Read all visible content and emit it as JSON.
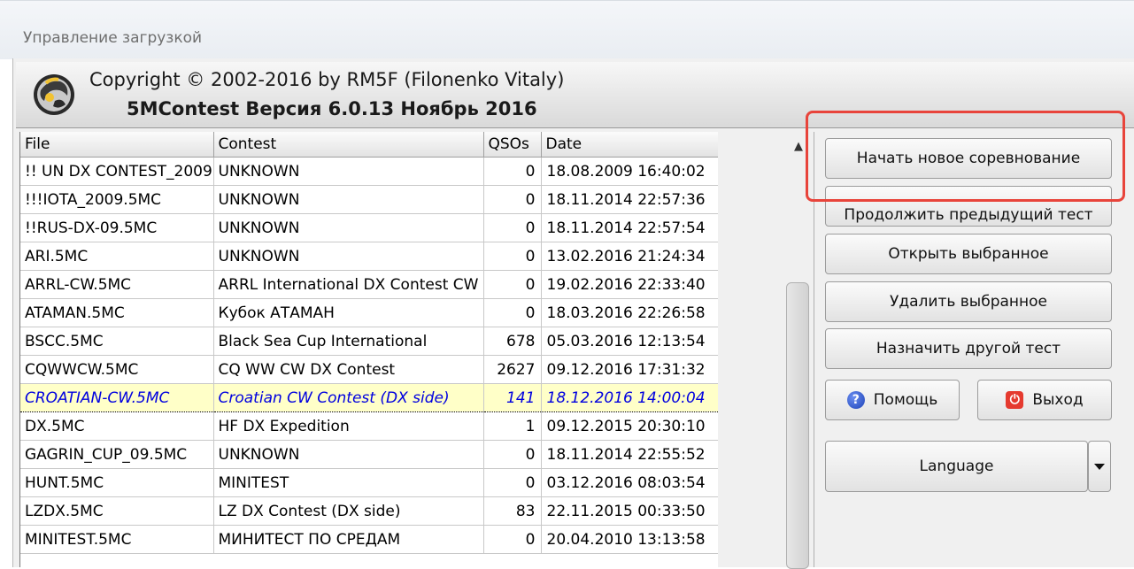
{
  "window": {
    "title": "Управление загрузкой"
  },
  "header": {
    "copyright": "Copyright © 2002-2016 by RM5F (Filonenko Vitaly)",
    "version": "5MContest Версия 6.0.13 Ноябрь 2016"
  },
  "grid": {
    "columns": [
      "File",
      "Contest",
      "QSOs",
      "Date"
    ],
    "rows": [
      {
        "file": "!! UN DX CONTEST_2009",
        "contest": "UNKNOWN",
        "qsos": "0",
        "date": "18.08.2009 16:40:02"
      },
      {
        "file": "!!!IOTA_2009.5MC",
        "contest": "UNKNOWN",
        "qsos": "0",
        "date": "18.11.2014 22:57:36"
      },
      {
        "file": "!!RUS-DX-09.5MC",
        "contest": "UNKNOWN",
        "qsos": "0",
        "date": "18.11.2014 22:57:54"
      },
      {
        "file": "ARI.5MC",
        "contest": "UNKNOWN",
        "qsos": "0",
        "date": "13.02.2016 21:24:34"
      },
      {
        "file": "ARRL-CW.5MC",
        "contest": "ARRL International DX Contest CW",
        "qsos": "0",
        "date": "19.02.2016 22:33:40"
      },
      {
        "file": "ATAMAN.5MC",
        "contest": "Кубок АТАМАН",
        "qsos": "0",
        "date": "18.03.2016 22:26:58"
      },
      {
        "file": "BSCC.5MC",
        "contest": "Black Sea Cup International",
        "qsos": "678",
        "date": "05.03.2016 12:13:54"
      },
      {
        "file": "CQWWCW.5MC",
        "contest": "CQ WW CW DX Contest",
        "qsos": "2627",
        "date": "09.12.2016 17:31:32"
      },
      {
        "file": "CROATIAN-CW.5MC",
        "contest": "Croatian CW Contest (DX side)",
        "qsos": "141",
        "date": "18.12.2016 14:00:04",
        "selected": true
      },
      {
        "file": "DX.5MC",
        "contest": "HF DX Expedition",
        "qsos": "1",
        "date": "09.12.2015 20:30:10"
      },
      {
        "file": "GAGRIN_CUP_09.5MC",
        "contest": "UNKNOWN",
        "qsos": "0",
        "date": "18.11.2014 22:55:52"
      },
      {
        "file": "HUNT.5MC",
        "contest": "MINITEST",
        "qsos": "0",
        "date": "03.12.2016 08:03:54"
      },
      {
        "file": "LZDX.5MC",
        "contest": "LZ DX Contest (DX side)",
        "qsos": "83",
        "date": "22.11.2015 00:33:50"
      },
      {
        "file": "MINITEST.5MC",
        "contest": "МИНИТЕСТ ПО СРЕДАМ",
        "qsos": "0",
        "date": "20.04.2010 13:13:58"
      }
    ]
  },
  "buttons": {
    "new_contest": "Начать новое соревнование",
    "continue_test": "Продолжить предыдущий тест",
    "open_selected": "Открыть выбранное",
    "delete_selected": "Удалить выбранное",
    "assign_other": "Назначить другой тест",
    "help": "Помощь",
    "exit": "Выход",
    "language": "Language"
  },
  "icons": {
    "help": "question-circle-icon",
    "exit": "power-icon",
    "scroll_up": "arrow-up-icon",
    "dropdown": "chevron-down-icon"
  },
  "colors": {
    "selected_row_bg": "#ffffc8",
    "selected_row_text": "#0000e0",
    "highlight_border": "#e8443b"
  }
}
